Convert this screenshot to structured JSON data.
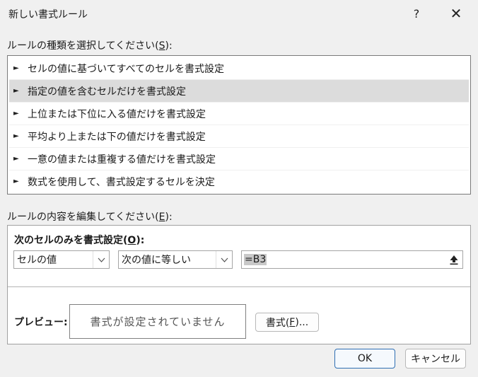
{
  "window": {
    "title": "新しい書式ルール",
    "help_symbol": "?",
    "close_symbol": "✕"
  },
  "rule_type": {
    "label_before": "ルールの種類を選択してください(",
    "label_key": "S",
    "label_after": "):",
    "items": [
      {
        "label": "セルの値に基づいてすべてのセルを書式設定"
      },
      {
        "label": "指定の値を含むセルだけを書式設定"
      },
      {
        "label": "上位または下位に入る値だけを書式設定"
      },
      {
        "label": "平均より上または下の値だけを書式設定"
      },
      {
        "label": "一意の値または重複する値だけを書式設定"
      },
      {
        "label": "数式を使用して、書式設定するセルを決定"
      }
    ],
    "selected_index": 1,
    "bullet": "►"
  },
  "edit_rule": {
    "label_before": "ルールの内容を編集してください(",
    "label_key": "E",
    "label_after": "):",
    "only_format_before": "次のセルのみを書式設定(",
    "only_format_key": "O",
    "only_format_after": "):",
    "condition_type": "セルの値",
    "operator": "次の値に等しい",
    "reference_prefix": "=",
    "reference_value": "B3",
    "preview_label": "プレビュー:",
    "preview_text": "書式が設定されていません",
    "format_button_before": "書式(",
    "format_button_key": "F",
    "format_button_after": ")..."
  },
  "buttons": {
    "ok": "OK",
    "cancel": "キャンセル"
  },
  "icons": {
    "dropdown": "chevron-down-icon",
    "range_select": "collapse-dialog-icon"
  }
}
